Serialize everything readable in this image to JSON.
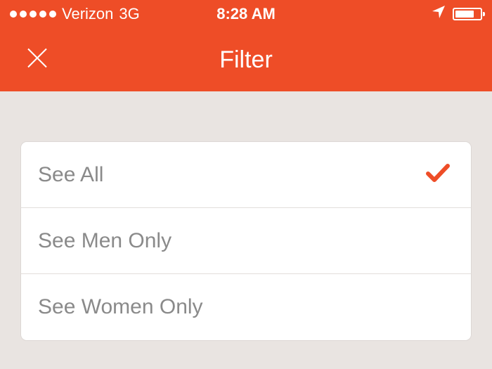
{
  "status": {
    "carrier": "Verizon",
    "network": "3G",
    "time": "8:28 AM"
  },
  "header": {
    "title": "Filter"
  },
  "filter": {
    "options": [
      {
        "label": "See All",
        "selected": true
      },
      {
        "label": "See Men Only",
        "selected": false
      },
      {
        "label": "See Women Only",
        "selected": false
      }
    ]
  }
}
